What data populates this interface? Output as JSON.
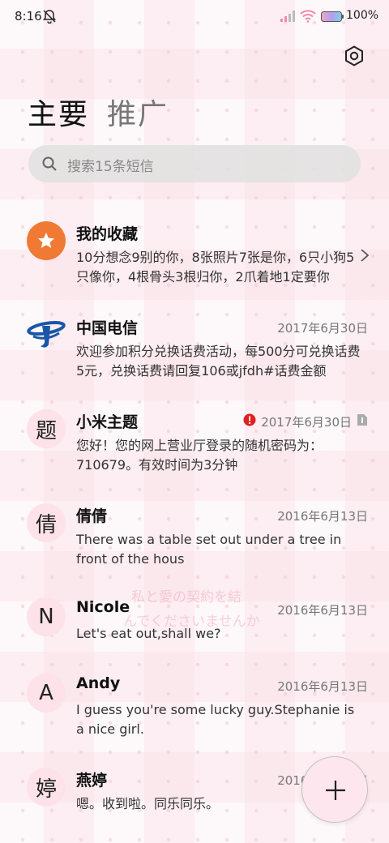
{
  "status_bar": {
    "time": "8:16",
    "battery": "100%"
  },
  "tabs": {
    "primary": "主要",
    "promotions": "推广"
  },
  "search": {
    "placeholder": "搜索15条短信"
  },
  "watermark": {
    "line1": "私と愛の契約を結",
    "line2": "んでくださいませんか"
  },
  "messages": [
    {
      "sender": "我的收藏",
      "date": "",
      "preview": "10分想念9别的你，8张照片7张是你，6只小狗5只像你，4根骨头3根归你，2爪着地1定要你",
      "avatar": "★",
      "icon": "star-icon"
    },
    {
      "sender": "中国电信",
      "date": "2017年6月30日",
      "preview": "欢迎参加积分兑换话费活动，每500分可兑换话费5元，兑换话费请回复106或jfdh#话费金额",
      "avatar": "",
      "icon": "china-telecom-logo"
    },
    {
      "sender": "小米主题",
      "date": "2017年6月30日",
      "preview": "您好！您的网上营业厅登录的随机密码为：710679。有效时间为3分钟",
      "avatar": "题"
    },
    {
      "sender": "倩倩",
      "date": "2016年6月13日",
      "preview": "There was a table set out under a tree in front of the hous",
      "avatar": "倩"
    },
    {
      "sender": "Nicole",
      "date": "2016年6月13日",
      "preview": "Let's eat out,shall we?",
      "avatar": "N"
    },
    {
      "sender": "Andy",
      "date": "2016年6月13日",
      "preview": "I guess you're some lucky guy.Stephanie is a nice girl.",
      "avatar": "A"
    },
    {
      "sender": "燕婷",
      "date": "2016年6月13日",
      "preview": "嗯。收到啦。同乐同乐。",
      "avatar": "婷"
    }
  ],
  "colors": {
    "accent_orange": "#f07a33",
    "avatar_pink": "#fde2ea",
    "telecom_blue": "#1a56a8",
    "error_red": "#e02020"
  }
}
